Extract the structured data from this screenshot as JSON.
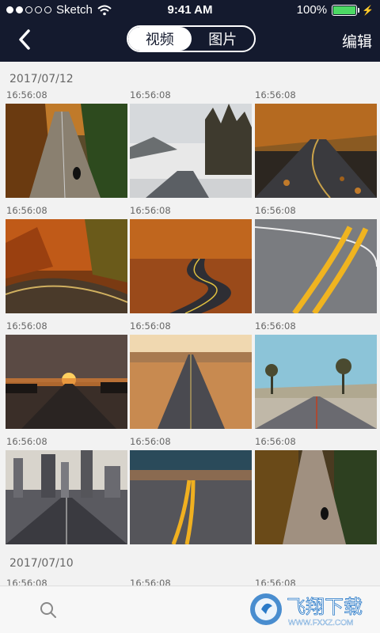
{
  "status_bar": {
    "carrier": "Sketch",
    "time": "9:41 AM",
    "battery": "100%"
  },
  "nav": {
    "segments": [
      "视频",
      "图片"
    ],
    "active_segment": 0,
    "edit_label": "编辑"
  },
  "groups": [
    {
      "date": "2017/07/12",
      "items": [
        {
          "time": "16:56:08"
        },
        {
          "time": "16:56:08"
        },
        {
          "time": "16:56:08"
        },
        {
          "time": "16:56:08"
        },
        {
          "time": "16:56:08"
        },
        {
          "time": "16:56:08"
        },
        {
          "time": "16:56:08"
        },
        {
          "time": "16:56:08"
        },
        {
          "time": "16:56:08"
        },
        {
          "time": "16:56:08"
        },
        {
          "time": "16:56:08"
        },
        {
          "time": "16:56:08"
        }
      ]
    },
    {
      "date": "2017/07/10",
      "items": [
        {
          "time": "16:56:08"
        },
        {
          "time": "16:56:08"
        },
        {
          "time": "16:56:08"
        }
      ]
    }
  ],
  "watermark": {
    "name": "飞翔下载",
    "url": "WWW.FXXZ.COM"
  },
  "colors": {
    "header_bg": "#141a2e",
    "battery_green": "#4cd964"
  }
}
